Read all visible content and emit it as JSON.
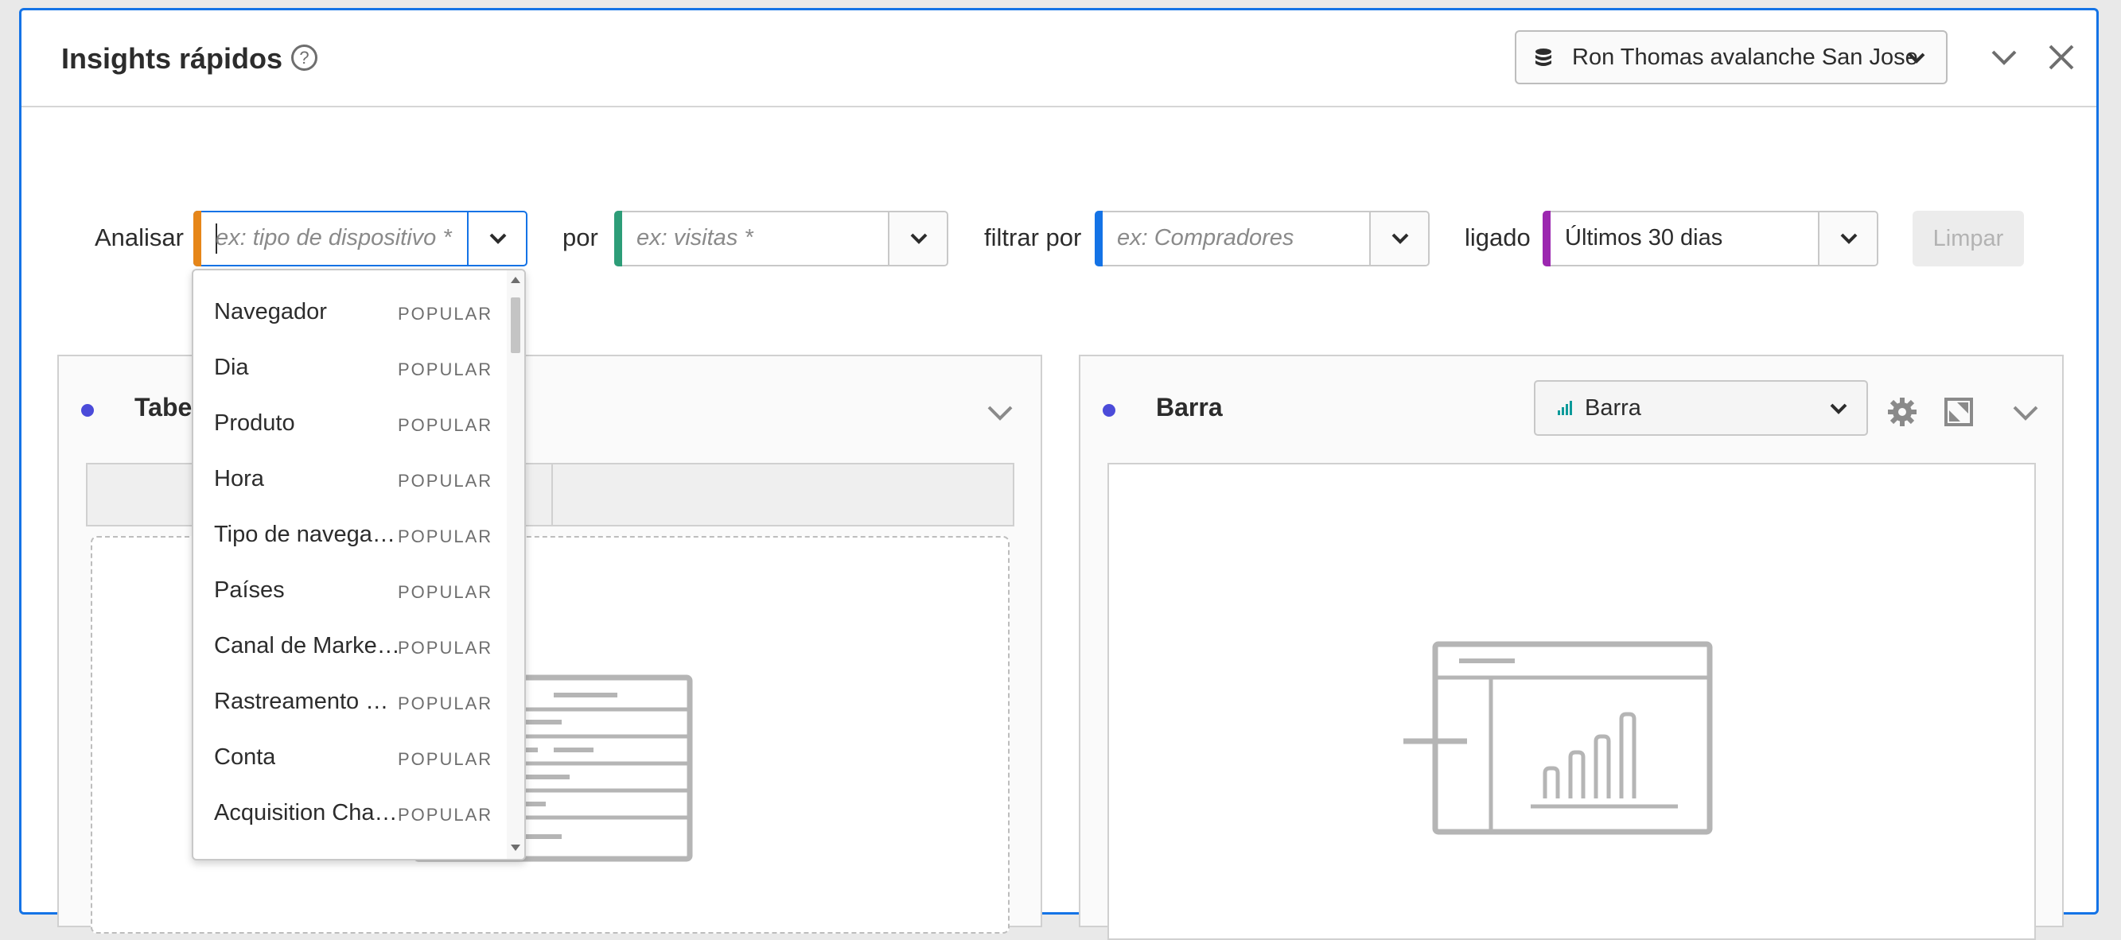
{
  "panel": {
    "title": "Insights rápidos",
    "report_suite": "Ron Thomas avalanche San Jose"
  },
  "query": {
    "analyze_label": "Analisar",
    "dimension_placeholder": "ex: tipo de dispositivo *",
    "by_label": "por",
    "metric_placeholder": "ex: visitas *",
    "filter_label": "filtrar por",
    "filter_placeholder": "ex: Compradores",
    "on_label": "ligado",
    "date_value": "Últimos 30 dias",
    "clear_label": "Limpar"
  },
  "dropdown": {
    "items": [
      {
        "name": "Navegador",
        "tag": "POPULAR"
      },
      {
        "name": "Dia",
        "tag": "POPULAR"
      },
      {
        "name": "Produto",
        "tag": "POPULAR"
      },
      {
        "name": "Hora",
        "tag": "POPULAR"
      },
      {
        "name": "Tipo de navegador",
        "tag": "POPULAR"
      },
      {
        "name": "Países",
        "tag": "POPULAR"
      },
      {
        "name": "Canal de Marketi...",
        "tag": "POPULAR"
      },
      {
        "name": "Rastreamento de...",
        "tag": "POPULAR"
      },
      {
        "name": "Conta",
        "tag": "POPULAR"
      },
      {
        "name": "Acquisition Chan...",
        "tag": "POPULAR"
      }
    ]
  },
  "cards": {
    "table_title": "Tabe",
    "bar_title": "Barra",
    "viz_type": "Barra"
  },
  "colors": {
    "accent": "#1473e6",
    "dimension_stripe": "#e68619",
    "metric_stripe": "#2d9d78",
    "filter_stripe": "#1473e6",
    "date_stripe": "#9c27b0",
    "card_dot": "#4b4bd9"
  }
}
